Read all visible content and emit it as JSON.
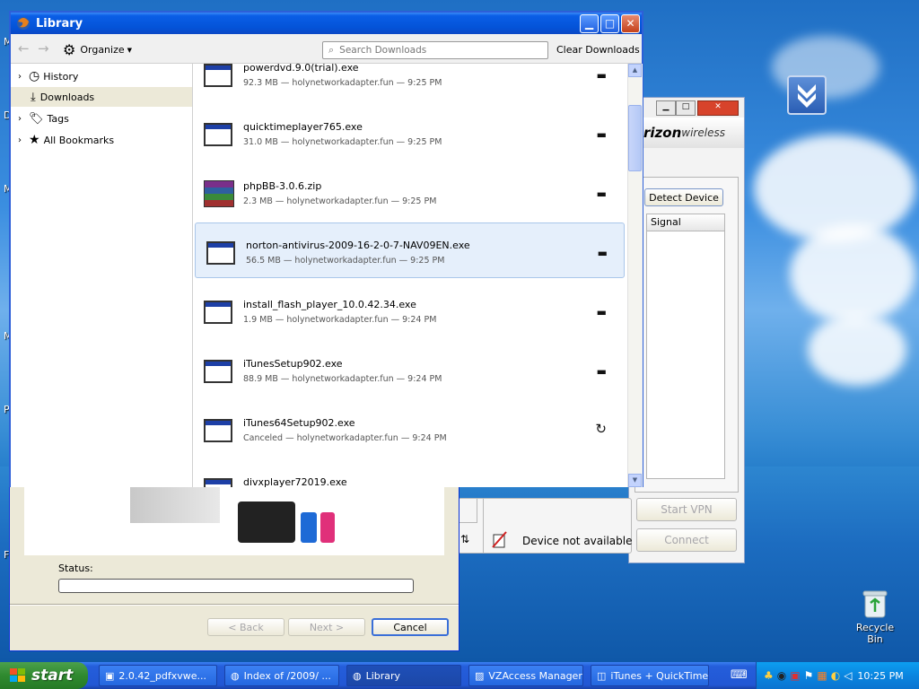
{
  "desktop": {
    "recycle_bin_label": "Recycle Bin",
    "left_edge_letters": [
      "M",
      "D",
      "M",
      "M",
      "P",
      "F"
    ]
  },
  "library": {
    "title": "Library",
    "organize_label": "Organize",
    "search_placeholder": "Search Downloads",
    "clear_label": "Clear Downloads",
    "nav": [
      {
        "label": "History"
      },
      {
        "label": "Downloads"
      },
      {
        "label": "Tags"
      },
      {
        "label": "All Bookmarks"
      }
    ],
    "downloads": [
      {
        "name": "powerdvd.9.0(trial).exe",
        "info": "92.3 MB — holynetworkadapter.fun — 9:25 PM",
        "action": "▬"
      },
      {
        "name": "quicktimeplayer765.exe",
        "info": "31.0 MB — holynetworkadapter.fun — 9:25 PM",
        "action": "▬"
      },
      {
        "name": "phpBB-3.0.6.zip",
        "info": "2.3 MB — holynetworkadapter.fun — 9:25 PM",
        "action": "▬"
      },
      {
        "name": "norton-antivirus-2009-16-2-0-7-NAV09EN.exe",
        "info": "56.5 MB — holynetworkadapter.fun — 9:25 PM",
        "action": "▬"
      },
      {
        "name": "install_flash_player_10.0.42.34.exe",
        "info": "1.9 MB — holynetworkadapter.fun — 9:24 PM",
        "action": "▬"
      },
      {
        "name": "iTunesSetup902.exe",
        "info": "88.9 MB — holynetworkadapter.fun — 9:24 PM",
        "action": "▬"
      },
      {
        "name": "iTunes64Setup902.exe",
        "info": "Canceled — holynetworkadapter.fun — 9:24 PM",
        "action": "↻"
      },
      {
        "name": "divxplayer72019.exe",
        "info": "",
        "action": "▬"
      }
    ]
  },
  "vz": {
    "brand_prefix": "rizon",
    "brand_suffix": "wireless",
    "detect_label": "Detect Device",
    "signal_header": "Signal",
    "device_status": "Device not available",
    "start_vpn": "Start VPN",
    "connect": "Connect"
  },
  "installer": {
    "status_label": "Status:",
    "progress": 0,
    "back": "< Back",
    "next": "Next >",
    "cancel": "Cancel"
  },
  "taskbar": {
    "start_label": "start",
    "buttons": [
      {
        "label": "2.0.42_pdfxvwe..."
      },
      {
        "label": "Index of /2009/ ..."
      },
      {
        "label": "Library"
      },
      {
        "label": "VZAccess Manager"
      },
      {
        "label": "iTunes + QuickTime"
      }
    ],
    "clock": "10:25 PM"
  }
}
